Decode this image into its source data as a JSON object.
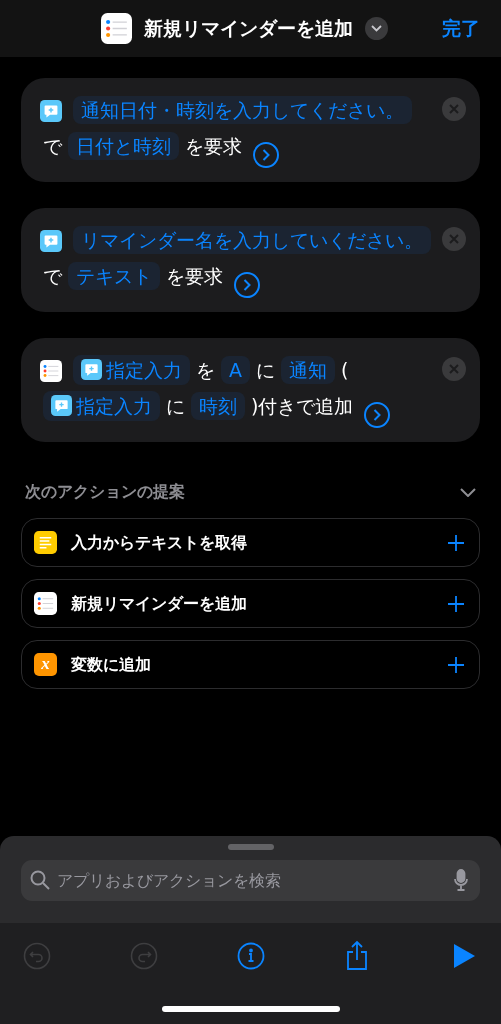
{
  "header": {
    "kind": "reminders",
    "title": "新規リマインダーを追加",
    "done": "完了"
  },
  "actions": [
    {
      "kind": "ask",
      "parts": [
        {
          "kind": "token",
          "text": "通知日付・時刻を入力してください。"
        },
        {
          "kind": "text",
          "text": "で"
        },
        {
          "kind": "token",
          "text": "日付と時刻"
        },
        {
          "kind": "text",
          "text": "を要求"
        }
      ]
    },
    {
      "kind": "ask",
      "parts": [
        {
          "kind": "token",
          "text": "リマインダー名を入力していください。"
        },
        {
          "kind": "text",
          "text": "で"
        },
        {
          "kind": "token",
          "text": "テキスト"
        },
        {
          "kind": "text",
          "text": "を要求"
        }
      ]
    },
    {
      "kind": "reminders",
      "parts": [
        {
          "kind": "variable",
          "text": "指定入力"
        },
        {
          "kind": "text",
          "text": "を"
        },
        {
          "kind": "token",
          "text": "A"
        },
        {
          "kind": "text",
          "text": "に"
        },
        {
          "kind": "token",
          "text": "通知"
        },
        {
          "kind": "text",
          "text": "("
        },
        {
          "kind": "variable",
          "text": "指定入力"
        },
        {
          "kind": "text",
          "text": "に"
        },
        {
          "kind": "token",
          "text": "時刻"
        },
        {
          "kind": "text",
          "text": ")付きで追加"
        }
      ]
    }
  ],
  "suggestions": {
    "title": "次のアクションの提案",
    "items": [
      {
        "kind": "text",
        "label": "入力からテキストを取得"
      },
      {
        "kind": "reminders",
        "label": "新規リマインダーを追加"
      },
      {
        "kind": "variable",
        "icon_text": "x",
        "label": "変数に追加"
      }
    ]
  },
  "search": {
    "placeholder": "アプリおよびアクションを検索"
  },
  "toolbar": [
    {
      "kind": "undo",
      "disabled": true
    },
    {
      "kind": "redo",
      "disabled": true
    },
    {
      "kind": "info",
      "disabled": false
    },
    {
      "kind": "share",
      "disabled": false
    },
    {
      "kind": "run",
      "disabled": false
    }
  ]
}
